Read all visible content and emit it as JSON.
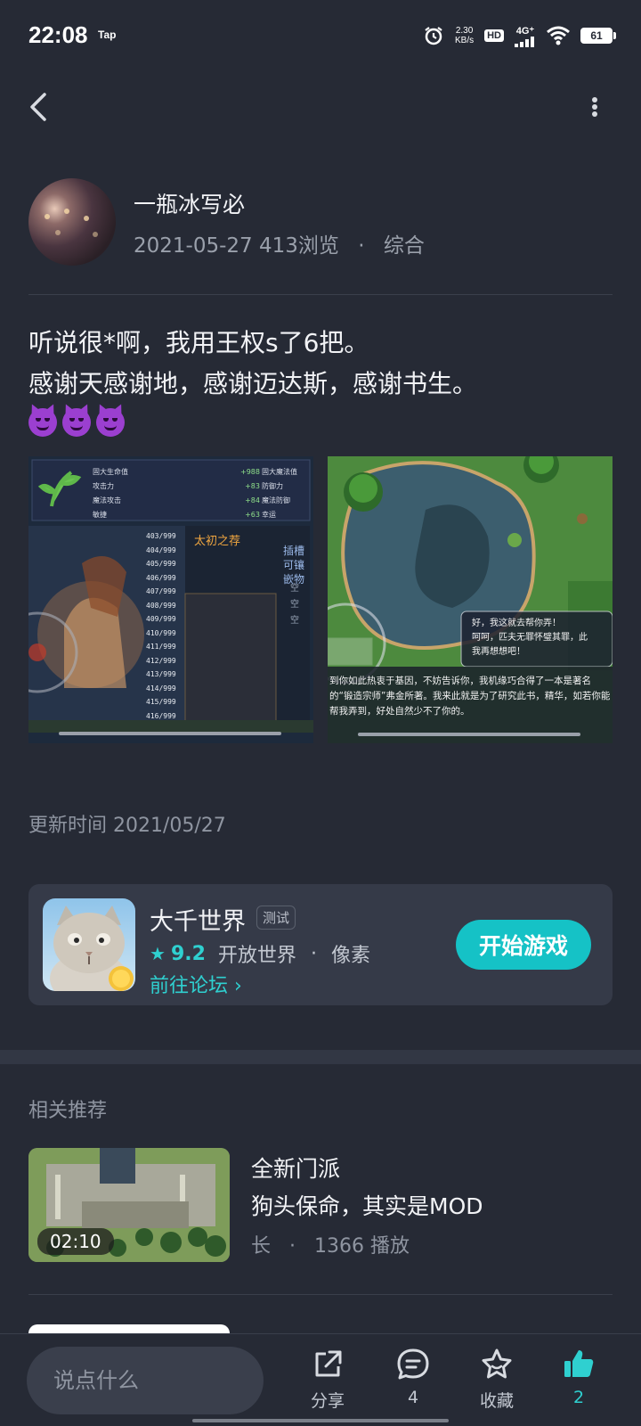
{
  "status_bar": {
    "time": "22:08",
    "tap_badge": "Tap",
    "net_speed_value": "2.30",
    "net_speed_unit": "KB/s",
    "hd": "HD",
    "network": "4G⁺",
    "battery": "61"
  },
  "post": {
    "author": "一瓶冰写必",
    "date": "2021-05-27",
    "views": "413浏览",
    "separator": "·",
    "category": "综合",
    "line1": "听说很*啊，我用王权s了6把。",
    "line2": "感谢天感谢地，感谢迈达斯，感谢书生。",
    "update_time": "更新时间 2021/05/27"
  },
  "shot1": {
    "stats_left": [
      "固大生命值",
      "攻击力",
      "魔法攻击",
      "敏捷"
    ],
    "stats_right_values": [
      "+988",
      "+83",
      "+84",
      "+63"
    ],
    "stats_right_names": [
      "固大魔法值",
      "防御力",
      "魔法防御",
      "幸运"
    ],
    "counts": [
      "403/999",
      "404/999",
      "405/999",
      "406/999",
      "407/999",
      "408/999",
      "409/999",
      "410/999",
      "411/999",
      "412/999",
      "413/999",
      "414/999",
      "415/999",
      "416/999"
    ],
    "item_name": "太初之荐",
    "slot_label": "插槽可镶嵌物",
    "slot_empty": "空"
  },
  "shot2": {
    "dialog_lines": [
      "好，我这就去帮你弄！",
      "呵呵，匹夫无罪怀璧其罪，此",
      "我再想想吧！"
    ],
    "narration": "到你如此热衷于基因，不妨告诉你，我机缘巧合得了一本是著名的“锻造宗师”弗金所著。我来此就是为了研究此书，精华，如若你能帮我弄到，好处自然少不了你的。"
  },
  "game": {
    "title": "大千世界",
    "badge": "测试",
    "rating": "9.2",
    "tag1": "开放世界",
    "dot": "·",
    "tag2": "像素",
    "forum_link": "前往论坛 ›",
    "play_label": "开始游戏"
  },
  "related": {
    "heading": "相关推荐",
    "item": {
      "duration": "02:10",
      "title_line1": "全新门派",
      "title_line2": "狗头保命，其实是MOD",
      "meta_author": "长",
      "meta_dot": "·",
      "meta_plays": "1366 播放"
    }
  },
  "bottom_bar": {
    "comment_placeholder": "说点什么",
    "share_label": "分享",
    "comment_count": "4",
    "favorite_label": "收藏",
    "like_count": "2"
  },
  "colors": {
    "background": "#262a35",
    "accent": "#15c2c6",
    "card": "#353a48"
  }
}
